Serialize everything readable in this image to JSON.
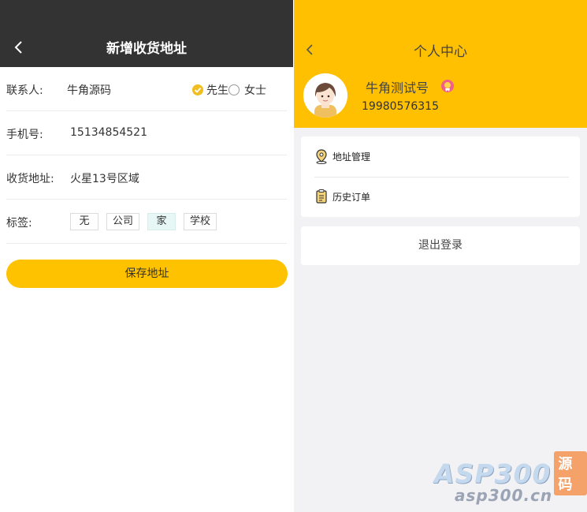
{
  "left": {
    "title": "新增收货地址",
    "contact": {
      "label": "联系人:",
      "value": "牛角源码",
      "options": [
        {
          "label": "先生",
          "selected": true
        },
        {
          "label": "女士",
          "selected": false
        }
      ]
    },
    "phone": {
      "label": "手机号:",
      "value": "15134854521"
    },
    "address": {
      "label": "收货地址:",
      "value": "火星13号区域"
    },
    "tags": {
      "label": "标签:",
      "items": [
        "无",
        "公司",
        "家",
        "学校"
      ],
      "selected": "家"
    },
    "save_label": "保存地址"
  },
  "right": {
    "title": "个人中心",
    "user": {
      "name": "牛角测试号",
      "phone": "19980576315"
    },
    "menu": [
      {
        "icon": "location-pin-icon",
        "label": "地址管理"
      },
      {
        "icon": "clipboard-icon",
        "label": "历史订单"
      }
    ],
    "logout_label": "退出登录"
  },
  "watermark": {
    "brand": "ASP300",
    "tag": "源码",
    "url": "asp300.cn"
  },
  "colors": {
    "dark_header": "#333333",
    "accent_yellow": "#ffc002",
    "button_yellow": "#fec200",
    "tag_selected": "#e6f7f5"
  }
}
